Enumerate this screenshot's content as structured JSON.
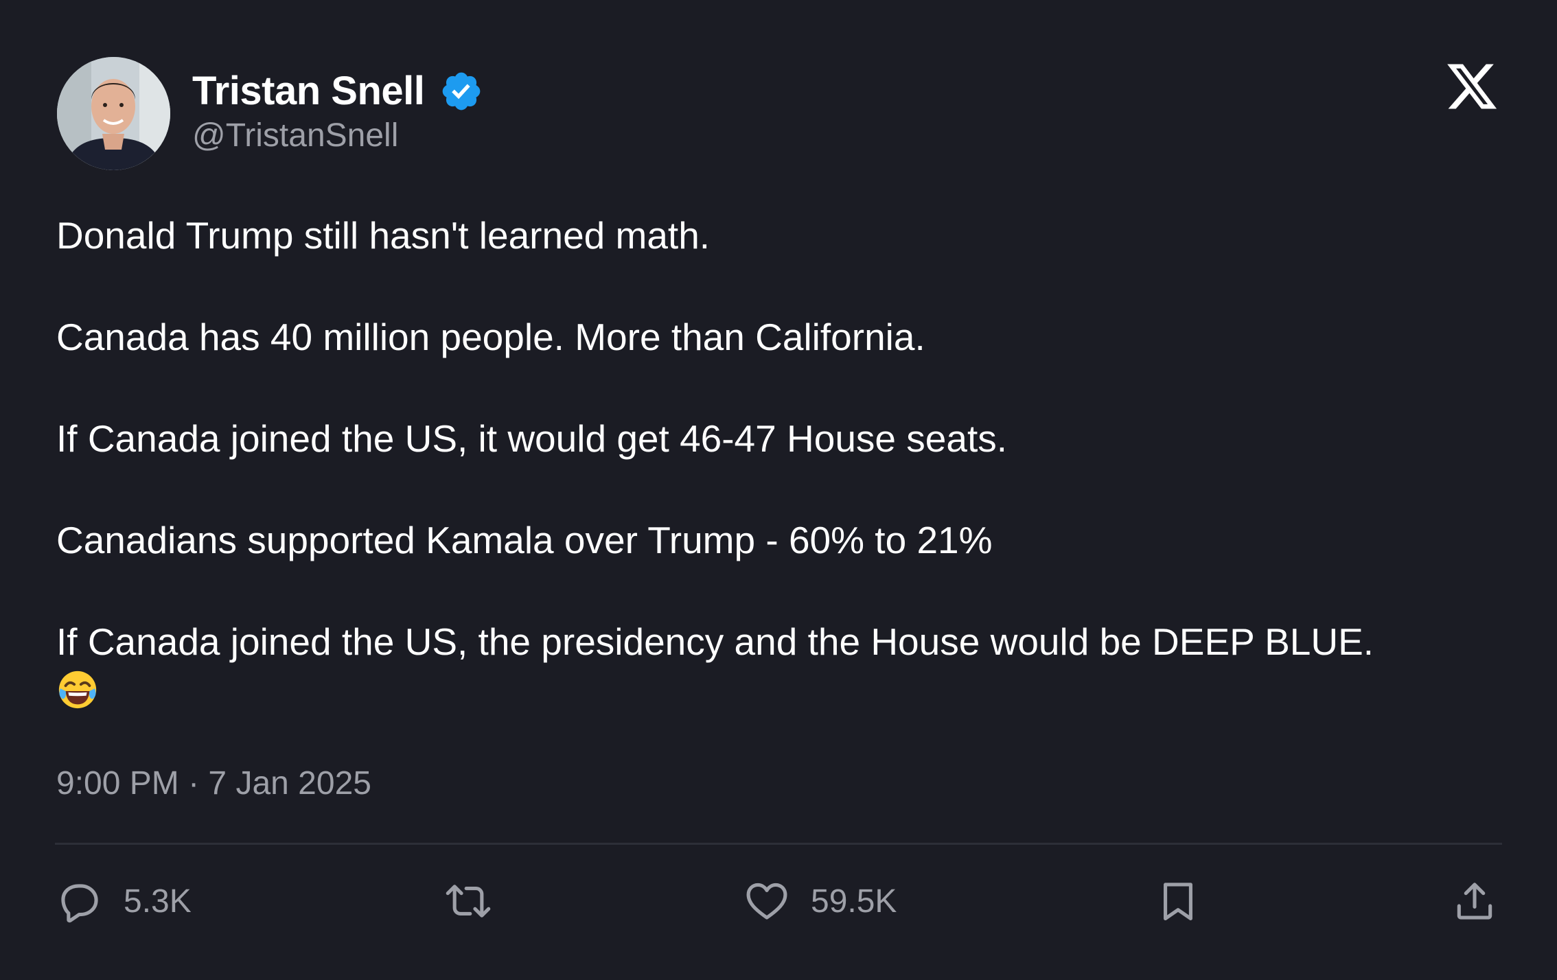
{
  "author": {
    "display_name": "Tristan Snell",
    "handle": "@TristanSnell",
    "verified": true
  },
  "brand_logo": "x-logo",
  "tweet": {
    "paragraphs": [
      "Donald Trump still hasn't learned math.",
      "Canada has 40 million people. More than California.",
      "If Canada joined the US, it would get 46-47 House seats.",
      "Canadians supported Kamala over Trump - 60% to 21%",
      "If Canada joined the US, the presidency and the House would be DEEP BLUE."
    ],
    "emoji": "face-with-tears-of-joy",
    "timestamp": "9:00 PM · 7 Jan 2025"
  },
  "actions": {
    "reply": {
      "icon": "reply-icon",
      "count": "5.3K"
    },
    "repost": {
      "icon": "repost-icon",
      "count": ""
    },
    "like": {
      "icon": "heart-icon",
      "count": "59.5K"
    },
    "bookmark": {
      "icon": "bookmark-icon"
    },
    "share": {
      "icon": "share-icon"
    }
  },
  "colors": {
    "background": "#1b1c24",
    "primary_text": "#ffffff",
    "secondary_text": "#9ea0a8",
    "verified_blue": "#1d9bf0",
    "divider": "#2d2f38"
  }
}
